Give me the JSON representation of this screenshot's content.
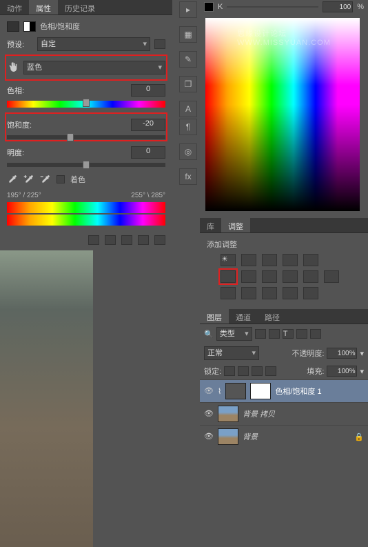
{
  "left": {
    "tabs": [
      "动作",
      "属性",
      "历史记录"
    ],
    "active_tab": 1,
    "title": "色相/饱和度",
    "preset_label": "预设:",
    "preset_value": "自定",
    "channel_value": "蓝色",
    "hue_label": "色相:",
    "hue_value": "0",
    "sat_label": "饱和度:",
    "sat_value": "-20",
    "light_label": "明度:",
    "light_value": "0",
    "colorize_label": "着色",
    "range_left": "195° / 225°",
    "range_right": "255° \\ 285°"
  },
  "top_right": {
    "k_label": "K",
    "k_value": "100",
    "k_unit": "%",
    "watermark_cn": "思缘设计论坛",
    "watermark_en": "WWW.MISSYUAN.COM"
  },
  "adjust": {
    "tabs": [
      "库",
      "调整"
    ],
    "title": "添加调整"
  },
  "layers": {
    "tabs": [
      "图层",
      "通道",
      "路径"
    ],
    "filter_label": "类型",
    "blend": "正常",
    "opacity_label": "不透明度:",
    "opacity_value": "100%",
    "lock_label": "锁定:",
    "fill_label": "填充:",
    "fill_value": "100%",
    "items": [
      {
        "name": "色相/饱和度 1",
        "type": "adj"
      },
      {
        "name": "背景 拷贝",
        "type": "img"
      },
      {
        "name": "背景",
        "type": "img",
        "locked": true
      }
    ]
  }
}
